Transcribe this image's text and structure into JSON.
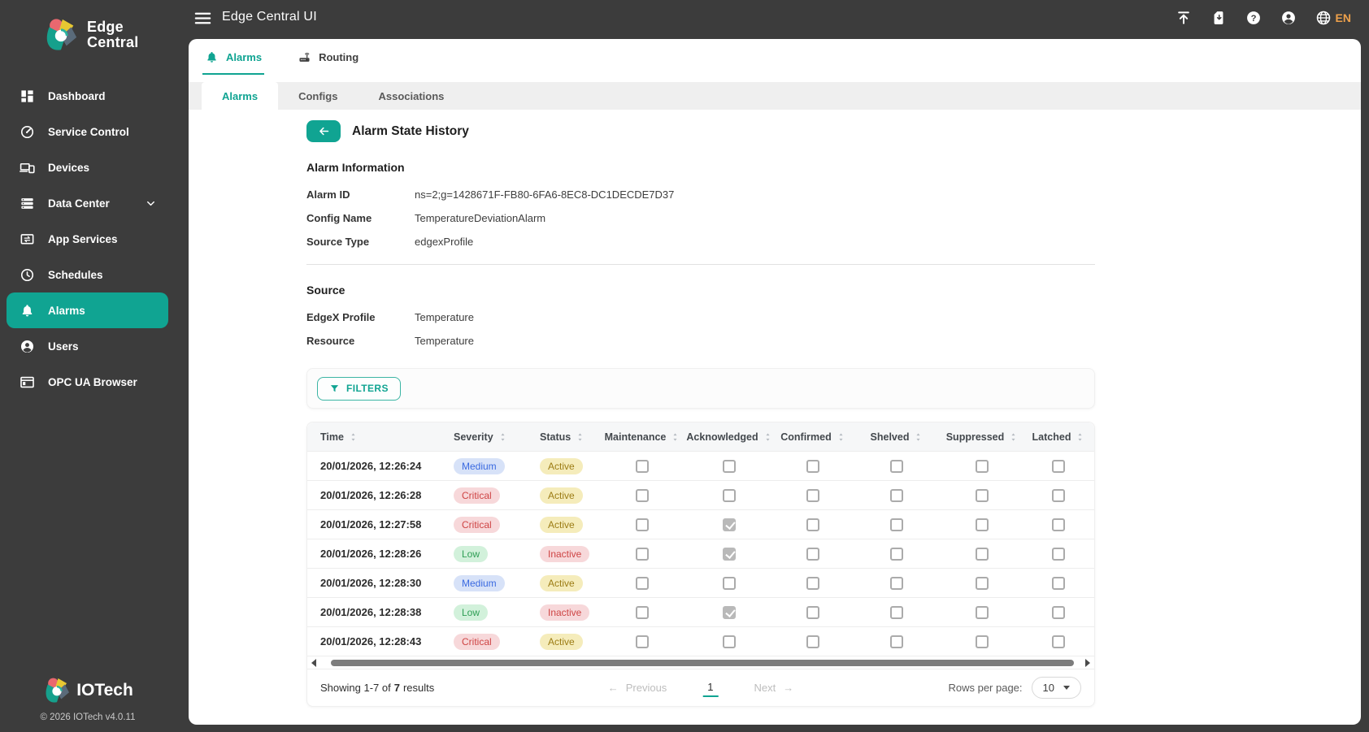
{
  "topbar": {
    "title": "Edge Central UI",
    "menu_icon": "hamburger-icon",
    "right_icons": [
      {
        "name": "upload-icon"
      },
      {
        "name": "sim-download-icon"
      },
      {
        "name": "help-icon"
      },
      {
        "name": "account-icon"
      },
      {
        "name": "globe-icon",
        "label": "EN"
      }
    ]
  },
  "sidebar": {
    "logo_line1": "Edge",
    "logo_line2": "Central",
    "items": [
      {
        "label": "Dashboard",
        "icon": "dashboard-icon",
        "active": false
      },
      {
        "label": "Service Control",
        "icon": "speed-icon",
        "active": false
      },
      {
        "label": "Devices",
        "icon": "devices-icon",
        "active": false
      },
      {
        "label": "Data Center",
        "icon": "storage-icon",
        "active": false,
        "expandable": true
      },
      {
        "label": "App Services",
        "icon": "app-services-icon",
        "active": false
      },
      {
        "label": "Schedules",
        "icon": "clock-icon",
        "active": false
      },
      {
        "label": "Alarms",
        "icon": "bell-icon",
        "active": true
      },
      {
        "label": "Users",
        "icon": "user-icon",
        "active": false
      },
      {
        "label": "OPC UA Browser",
        "icon": "browser-icon",
        "active": false
      }
    ],
    "footer_logo": "IOTech",
    "copyright": "© 2026 IOTech v4.0.11"
  },
  "main_tabs": [
    {
      "label": "Alarms",
      "icon": "bell-icon",
      "active": true
    },
    {
      "label": "Routing",
      "icon": "router-icon",
      "active": false
    }
  ],
  "subtabs": [
    {
      "label": "Alarms",
      "active": true
    },
    {
      "label": "Configs",
      "active": false
    },
    {
      "label": "Associations",
      "active": false
    }
  ],
  "page": {
    "title": "Alarm State History",
    "back_icon": "back-arrow-icon",
    "sections": [
      {
        "heading": "Alarm Information",
        "fields": [
          {
            "label": "Alarm ID",
            "value": "ns=2;g=1428671F-FB80-6FA6-8EC8-DC1DECDE7D37"
          },
          {
            "label": "Config Name",
            "value": "TemperatureDeviationAlarm"
          },
          {
            "label": "Source Type",
            "value": "edgexProfile"
          }
        ]
      },
      {
        "heading": "Source",
        "fields": [
          {
            "label": "EdgeX Profile",
            "value": "Temperature"
          },
          {
            "label": "Resource",
            "value": "Temperature"
          }
        ]
      }
    ]
  },
  "filters": {
    "button_label": "FILTERS",
    "icon": "funnel-icon"
  },
  "table": {
    "columns": [
      "Time",
      "Severity",
      "Status",
      "Maintenance",
      "Acknowledged",
      "Confirmed",
      "Shelved",
      "Suppressed",
      "Latched"
    ],
    "rows": [
      {
        "time": "20/01/2026, 12:26:24",
        "severity": "Medium",
        "status": "Active",
        "maintenance": false,
        "acknowledged": false,
        "confirmed": false,
        "shelved": false,
        "suppressed": false,
        "latched": false
      },
      {
        "time": "20/01/2026, 12:26:28",
        "severity": "Critical",
        "status": "Active",
        "maintenance": false,
        "acknowledged": false,
        "confirmed": false,
        "shelved": false,
        "suppressed": false,
        "latched": false
      },
      {
        "time": "20/01/2026, 12:27:58",
        "severity": "Critical",
        "status": "Active",
        "maintenance": false,
        "acknowledged": true,
        "confirmed": false,
        "shelved": false,
        "suppressed": false,
        "latched": false
      },
      {
        "time": "20/01/2026, 12:28:26",
        "severity": "Low",
        "status": "Inactive",
        "maintenance": false,
        "acknowledged": true,
        "confirmed": false,
        "shelved": false,
        "suppressed": false,
        "latched": false
      },
      {
        "time": "20/01/2026, 12:28:30",
        "severity": "Medium",
        "status": "Active",
        "maintenance": false,
        "acknowledged": false,
        "confirmed": false,
        "shelved": false,
        "suppressed": false,
        "latched": false
      },
      {
        "time": "20/01/2026, 12:28:38",
        "severity": "Low",
        "status": "Inactive",
        "maintenance": false,
        "acknowledged": true,
        "confirmed": false,
        "shelved": false,
        "suppressed": false,
        "latched": false
      },
      {
        "time": "20/01/2026, 12:28:43",
        "severity": "Critical",
        "status": "Active",
        "maintenance": false,
        "acknowledged": false,
        "confirmed": false,
        "shelved": false,
        "suppressed": false,
        "latched": false
      }
    ]
  },
  "pagination": {
    "showing_prefix": "Showing 1-7 of",
    "total": "7",
    "showing_suffix": "results",
    "previous_label": "Previous",
    "page": "1",
    "next_label": "Next",
    "rows_per_page_label": "Rows per page:",
    "rows_per_page": "10"
  },
  "colors": {
    "accent_teal": "#10a492",
    "sidebar_bg": "#3c3c3c",
    "language_fg": "#eda04b",
    "severity_medium_bg": "#d7e2f8",
    "severity_medium_fg": "#3a6ae0",
    "severity_critical_bg": "#f7d8da",
    "severity_critical_fg": "#ce4444",
    "severity_low_bg": "#d2f1db",
    "severity_low_fg": "#2f9e55",
    "status_active_bg": "#f5ecbb",
    "status_active_fg": "#9c7c14",
    "status_inactive_bg": "#f7d8da",
    "status_inactive_fg": "#ce4444",
    "checked_checkbox": "#b9b9b9"
  }
}
